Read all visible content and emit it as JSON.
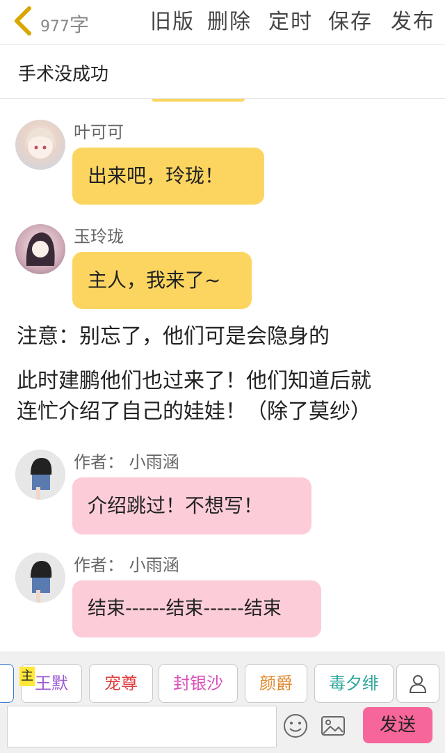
{
  "header": {
    "word_count": "977",
    "word_unit": "字",
    "buttons": {
      "old": "旧版",
      "delete": "删除",
      "schedule": "定时",
      "save": "保存",
      "publish": "发布"
    }
  },
  "story_title": "手术没成功",
  "messages": [
    {
      "name": "叶可可",
      "text": "出来吧，玲珑！",
      "color": "yellow"
    },
    {
      "name": "玉玲珑",
      "text": "主人，我来了~",
      "color": "yellow"
    }
  ],
  "narration": {
    "line1": "注意：别忘了，他们可是会隐身的",
    "line2": "此时建鹏他们也过来了！他们知道后就",
    "line3": "连忙介绍了自己的娃娃！（除了莫纱）"
  },
  "author_messages": [
    {
      "name": "作者： 小雨涵",
      "text": "介绍跳过！不想写！"
    },
    {
      "name": "作者： 小雨涵",
      "text": "结束------结束------结束"
    }
  ],
  "characters": {
    "main_tag": "主",
    "chips": [
      {
        "label": "王默",
        "color": "#9b59d0"
      },
      {
        "label": "宠尊",
        "color": "#e04040"
      },
      {
        "label": "封银沙",
        "color": "#d94fb8"
      },
      {
        "label": "颜爵",
        "color": "#e08a30"
      },
      {
        "label": "毒夕绯",
        "color": "#2aa59b"
      }
    ]
  },
  "input": {
    "placeholder": ""
  },
  "send_label": "发送",
  "colors": {
    "yellow_bubble": "#fcd560",
    "pink_bubble": "#fccdd8",
    "send": "#f7669a"
  }
}
